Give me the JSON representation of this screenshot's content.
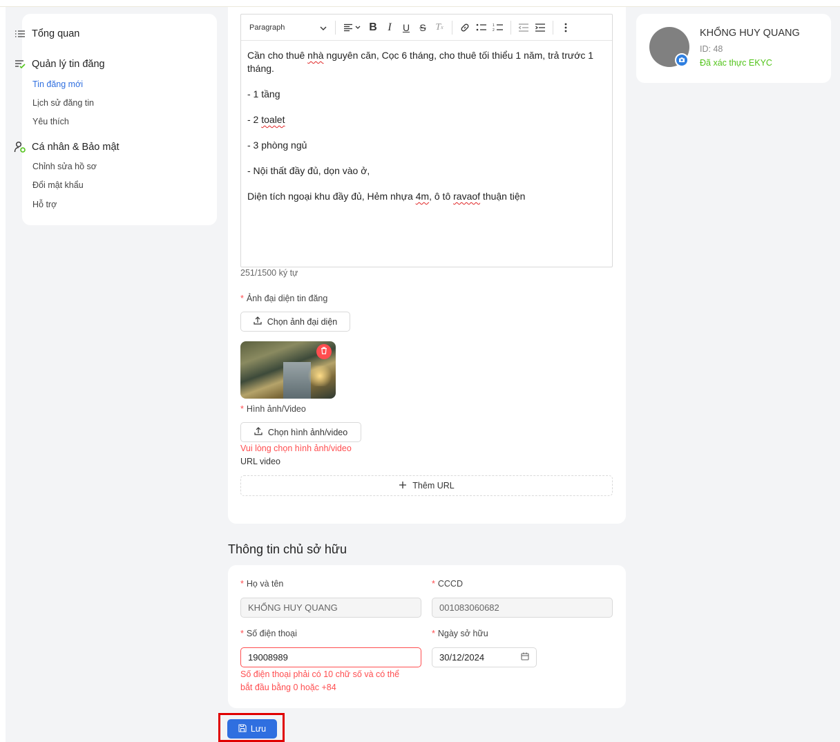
{
  "sidebar": {
    "sections": [
      {
        "label": "Tổng quan",
        "icon": "list-icon"
      },
      {
        "label": "Quản lý tin đăng",
        "icon": "list-check-icon"
      },
      {
        "label": "Cá nhân & Bảo mật",
        "icon": "user-settings-icon"
      }
    ],
    "sub_items_listing": [
      "Tin đăng mới",
      "Lịch sử đăng tin",
      "Yêu thích"
    ],
    "sub_items_personal": [
      "Chỉnh sửa hồ sơ",
      "Đổi mật khẩu",
      "Hỗ trợ"
    ],
    "active_item": "Tin đăng mới"
  },
  "editor": {
    "block_format": "Paragraph",
    "content": {
      "p1a": "Cần cho thuê ",
      "p1_sp": "nhà",
      "p1b": " nguyên căn, Cọc 6 tháng, cho thuê tối thiểu 1 năm, trả trước 1 tháng.",
      "p2": "- 1 tầng",
      "p3a": "- 2 ",
      "p3_sp": "toalet",
      "p4": "- 3 phòng ngủ",
      "p5": "- Nội thất đầy đủ, dọn vào ở,",
      "p6a": "Diện tích ngoại khu đầy đủ, Hẻm nhựa ",
      "p6_sp1": "4m",
      "p6b": ", ô tô ",
      "p6_sp2": "ravaof",
      "p6c": " thuận tiện"
    },
    "char_count": "251/1500 ký tự"
  },
  "cover_image": {
    "label": "Ảnh đại diện tin đăng",
    "button": "Chọn ảnh đại diện"
  },
  "media": {
    "label": "Hình ảnh/Video",
    "button": "Chọn hình ảnh/video",
    "error": "Vui lòng chọn hình ảnh/video",
    "url_label": "URL video",
    "add_url": "Thêm URL"
  },
  "owner": {
    "title": "Thông tin chủ sở hữu",
    "name_label": "Họ và tên",
    "name_value": "KHỔNG HUY QUANG",
    "id_label": "CCCD",
    "id_value": "001083060682",
    "phone_label": "Số điện thoại",
    "phone_value": "19008989",
    "phone_error_line1": "Số điện thoại phải có 10 chữ số và có thể",
    "phone_error_line2": "bắt đầu bằng 0 hoặc +84",
    "date_label": "Ngày sở hữu",
    "date_value": "30/12/2024"
  },
  "save_button": "Lưu",
  "profile": {
    "name": "KHỔNG HUY QUANG",
    "id": "ID: 48",
    "status": "Đã xác thực EKYC"
  },
  "colors": {
    "primary": "#2f6fe0",
    "error": "#ff4d4f",
    "success": "#52c41a",
    "highlight": "#e00000"
  }
}
